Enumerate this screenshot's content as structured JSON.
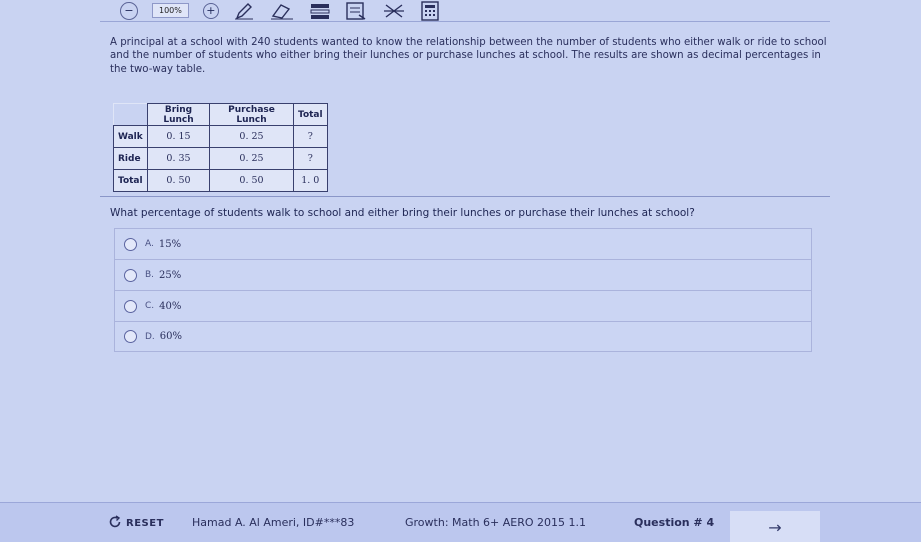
{
  "toolbar": {
    "zoom_minus": "−",
    "zoom_level": "100%",
    "zoom_plus": "+",
    "icons": [
      "pencil-icon",
      "eraser-icon",
      "highlighter-icon",
      "notepad-icon",
      "strikethrough-icon",
      "calculator-icon"
    ]
  },
  "question": {
    "prompt": "A principal at a school with 240 students wanted to know the relationship between the number of students who either walk or ride to school and the number of students who either bring their lunches or purchase lunches at school. The results are shown as decimal percentages in the two-way table.",
    "table": {
      "headers": [
        "Bring Lunch",
        "Purchase Lunch",
        "Total"
      ],
      "rows": [
        {
          "label": "Walk",
          "values": [
            "0. 15",
            "0. 25",
            "?"
          ]
        },
        {
          "label": "Ride",
          "values": [
            "0. 35",
            "0. 25",
            "?"
          ]
        },
        {
          "label": "Total",
          "values": [
            "0. 50",
            "0. 50",
            "1. 0"
          ]
        }
      ]
    },
    "text": "What percentage of students walk to school and either bring their lunches or purchase their lunches at school?",
    "answers": [
      {
        "letter": "A.",
        "text": "15%"
      },
      {
        "letter": "B.",
        "text": "25%"
      },
      {
        "letter": "C.",
        "text": "40%"
      },
      {
        "letter": "D.",
        "text": "60%"
      }
    ]
  },
  "footer": {
    "reset_label": "RESET",
    "student": "Hamad A. Al Ameri, ID#***83",
    "test": "Growth: Math 6+ AERO 2015 1.1",
    "question_number": "Question # 4",
    "next_arrow": "→"
  }
}
